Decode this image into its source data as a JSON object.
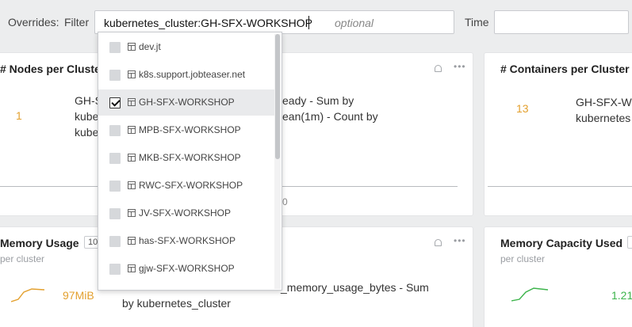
{
  "overrides": {
    "overrides_label": "Overrides:",
    "filter_label": "Filter",
    "filter_value": "kubernetes_cluster:GH-SFX-WORKSHOP",
    "filter_optional_hint": "optional",
    "time_label": "Time",
    "time_value": ""
  },
  "dropdown": {
    "items": [
      {
        "label": "dev.jt",
        "checked": false
      },
      {
        "label": "k8s.support.jobteaser.net",
        "checked": false
      },
      {
        "label": "GH-SFX-WORKSHOP",
        "checked": true
      },
      {
        "label": "MPB-SFX-WORKSHOP",
        "checked": false
      },
      {
        "label": "MKB-SFX-WORKSHOP",
        "checked": false
      },
      {
        "label": "RWC-SFX-WORKSHOP",
        "checked": false
      },
      {
        "label": "JV-SFX-WORKSHOP",
        "checked": false
      },
      {
        "label": "has-SFX-WORKSHOP",
        "checked": false
      },
      {
        "label": "gjw-SFX-WORKSHOP",
        "checked": false
      }
    ]
  },
  "cards": {
    "nodes": {
      "title": "# Nodes per Cluster",
      "value": "1",
      "legend_line1": "GH-S",
      "legend_line2": "kube",
      "legend_line3": "kube",
      "legend_right1": "eady - Sum by",
      "legend_right2": "ean(1m) - Count by",
      "axis_tick": "0"
    },
    "containers": {
      "title": "# Containers per Cluster",
      "value": "13",
      "legend_line1": "GH-SFX-WO",
      "legend_line2": "kubernetes"
    },
    "memory_usage": {
      "title": "Memory Usage",
      "badge": "10",
      "subtitle": "per cluster",
      "value": "97MiB",
      "legend_line1": "_memory_usage_bytes - Sum",
      "legend_line2": "by kubernetes_cluster"
    },
    "memory_capacity": {
      "title": "Memory Capacity Used",
      "subtitle": "per cluster",
      "value": "1.21"
    }
  },
  "colors": {
    "accent_value": "#e3a02e",
    "green_value": "#3cb44b"
  }
}
